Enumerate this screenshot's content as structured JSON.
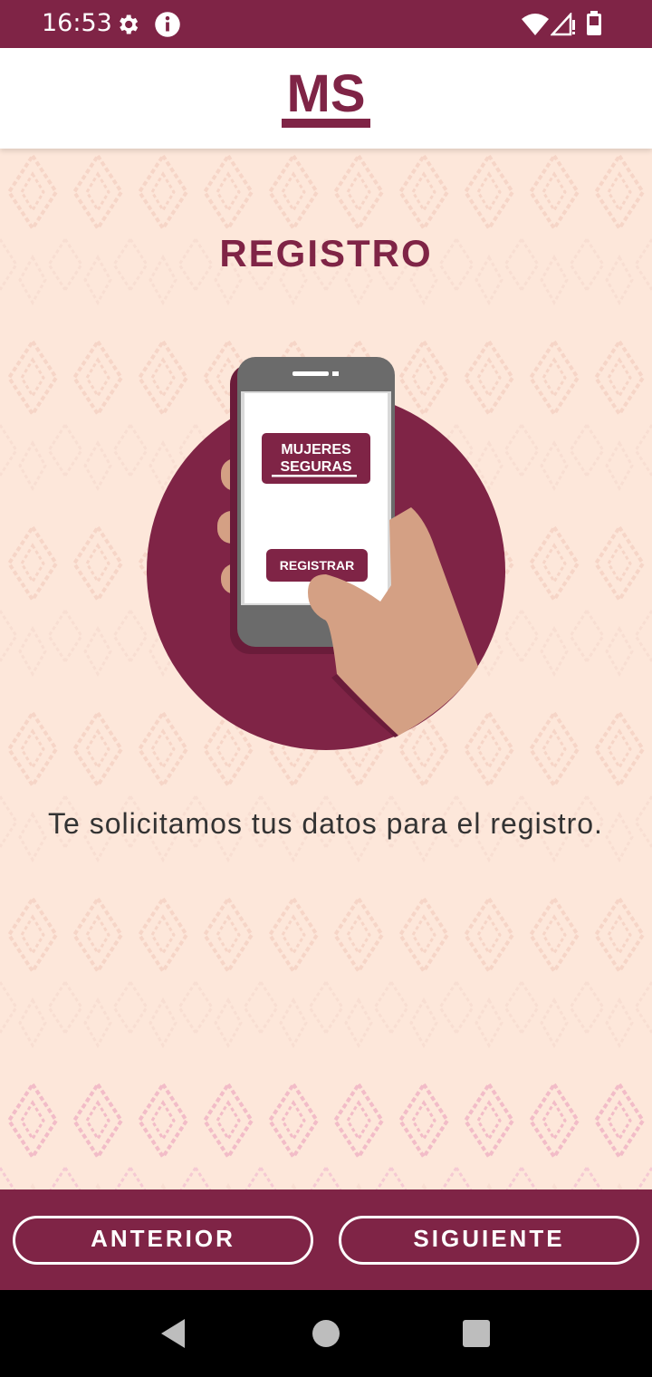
{
  "status_bar": {
    "time": "16:53",
    "icons": [
      "settings-icon",
      "info-icon",
      "wifi-icon",
      "signal-icon",
      "battery-icon"
    ]
  },
  "header": {
    "logo_text": "MS"
  },
  "page": {
    "title": "REGISTRO",
    "illustration": {
      "app_name_line1": "MUJERES",
      "app_name_line2": "SEGURAS",
      "register_button": "REGISTRAR"
    },
    "message": "Te solicitamos tus datos para el registro."
  },
  "footer": {
    "previous_label": "ANTERIOR",
    "next_label": "SIGUIENTE"
  },
  "colors": {
    "brand": "#7f2446",
    "background": "#fde7da",
    "skin": "#d4a084",
    "phone_gray": "#6b6b6b"
  },
  "system_nav": {
    "icons": [
      "back-icon",
      "home-icon",
      "recents-icon"
    ]
  }
}
